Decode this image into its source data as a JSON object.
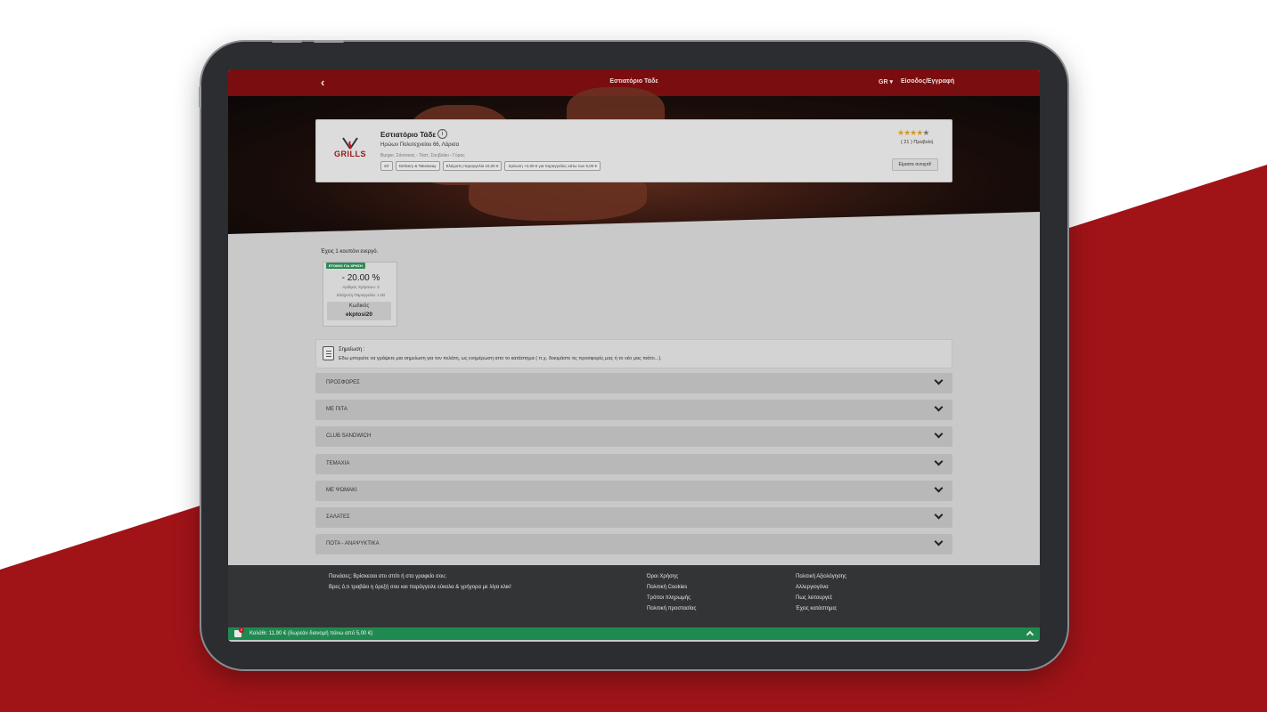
{
  "header": {
    "title": "Εστιατόριο Τάδε",
    "language": "GR ▾",
    "login": "Είσοδος/Εγγραφή"
  },
  "restaurant": {
    "logo_text": "GRILLS",
    "name": "Εστιατόριο Τάδε",
    "address": "Ηρώων Πολυτεχνείου 66, Λάρισα",
    "categories": "Burger, Σάντουιτς - Τόστ, Σουβλάκι - Γύρος",
    "tags": [
      "20'",
      "Delivery & Takeaway",
      "Ελάχιστη παραγγελία 10,00 €",
      "Χρέωση +2,00 € για παραγγελίες κάτω των 5,00 €"
    ],
    "rating_stars": 4,
    "reviews": "( 21 ) Προβολή",
    "open_button": "Είμαστε ανοιχτά!"
  },
  "coupon": {
    "heading": "Έχεις 1 κουπόνι ενεργό.",
    "badge": "ΕΤΟΙΜΟ ΓΙΑ ΧΡΗΣΗ",
    "discount": "- 20.00 %",
    "uses": "Αριθμός Χρήσεων: 3",
    "min_order": "Ελάχιστη Παραγγελία: 1.00",
    "code_label": "Κωδικός",
    "code": "ekptosi20"
  },
  "note": {
    "title": "Σημείωση :",
    "text": "Εδω μπορείτε να γράψετε μια σημείωση για τον πελάτη, ως ενημέρωση απο το κατάστημα ( π.χ. δοκιμάστε τις προσφορές μας ή το νέο μας πιάτο...)."
  },
  "categories": [
    "ΠΡΟΣΦΟΡΕΣ",
    "ΜΕ ΠΙΤΑ",
    "CLUB SANDWICH",
    "ΤΕΜΑΧΙΑ",
    "ΜΕ ΨΩΜΑΚΙ",
    "ΣΑΛΑΤΕΣ",
    "ΠΟΤΑ - ΑΝΑΨΥΚΤΙΚΑ"
  ],
  "footer": {
    "tagline1": "Πεινάσες; Βρίσκεσαι στο σπίτι ή στο γραφείο σου;",
    "tagline2": "Βρες ό,τι τραβάει η όρεξή σου και παράγγειλε εύκολα & γρήγορα με λίγα κλικ!",
    "col1": [
      "Όροι Χρήσης",
      "Πολιτική Cookies",
      "Τρόποι πληρωμής",
      "Πολιτική προστασίας"
    ],
    "col2": [
      "Πολιτική Αξιολόγησης",
      "Αλλεργιογόνα",
      "Πως λειτουργεί;",
      "Έχεις κατάστημα;"
    ]
  },
  "cart": {
    "count": "2",
    "text": "Καλάθι: 11,90 €   (δωρεάν διανομή πάνω από 5,00 €)"
  },
  "colors": {
    "topbar": "#7a0d0f",
    "cart": "#1f8a4f",
    "badge": "#2e8b57",
    "backdrop_red": "#a01418"
  }
}
